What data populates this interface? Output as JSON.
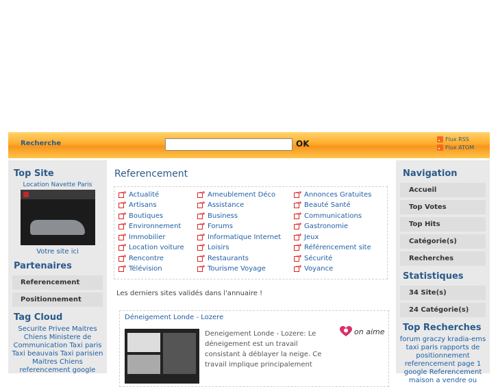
{
  "header": {
    "search_label": "Recherche",
    "search_value": "",
    "ok_label": "OK",
    "feeds": [
      "Flux RSS",
      "Flux ATOM"
    ],
    "accent": "#f7951d"
  },
  "left": {
    "top_site_title": "Top Site",
    "top_site_name": "Location Navette Paris",
    "votre_site": "Votre site ici",
    "partenaires_title": "Partenaires",
    "partenaires": [
      "Referencement",
      "Positionnement"
    ],
    "tag_cloud_title": "Tag Cloud",
    "tag_cloud_text": "Securite Privee Maitres Chiens Ministere de Communication Taxi paris Taxi beauvais Taxi parisien Maitres Chiens referencement google"
  },
  "center": {
    "title": "Referencement",
    "categories": [
      "Actualité",
      "Ameublement Déco",
      "Annonces Gratuites",
      "Artisans",
      "Assistance",
      "Beauté Santé",
      "Boutiques",
      "Business",
      "Communications",
      "Environnement",
      "Forums",
      "Gastronomie",
      "Immobilier",
      "Informatique Internet",
      "Jeux",
      "Location voiture",
      "Loisirs",
      "Référencement site",
      "Rencontre",
      "Restaurants",
      "Sécurité",
      "Télévision",
      "Tourisme Voyage",
      "Voyance"
    ],
    "latest_text": "Les derniers sites validés dans l'annuaire !",
    "site": {
      "title": "Déneigement Londe - Lozere",
      "desc": "Deneigement Londe - Lozere: Le déneigement est un travail consistant à déblayer la neige. Ce travail implique principalement",
      "on_aime": "on aime"
    }
  },
  "right": {
    "navigation_title": "Navigation",
    "navigation": [
      "Accueil",
      "Top Votes",
      "Top Hits",
      "Catégorie(s)",
      "Recherches"
    ],
    "stats_title": "Statistiques",
    "stats": [
      "34 Site(s)",
      "24 Catégorie(s)"
    ],
    "top_recherches_title": "Top Recherches",
    "top_recherches_text": "forum graczy kradia-ems taxi paris rapports de positionnement referencement page 1 google Referencement maison a vendre ou"
  }
}
